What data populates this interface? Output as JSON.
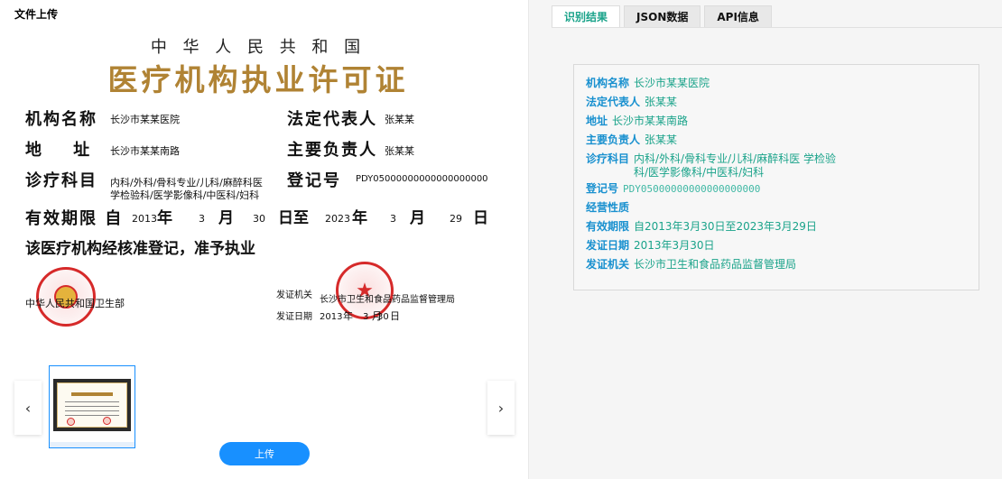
{
  "left": {
    "title": "文件上传",
    "upload_label": "上传",
    "prev_icon": "‹",
    "next_icon": "›"
  },
  "license": {
    "header": "中 华 人 民 共 和 国",
    "title": "医疗机构执业许可证",
    "lbl_name": "机构名称",
    "val_name": "长沙市某某医院",
    "lbl_rep": "法定代表人",
    "val_rep": "张某某",
    "lbl_addr": "地    址",
    "val_addr": "长沙市某某南路",
    "lbl_chief": "主要负责人",
    "val_chief": "张某某",
    "lbl_subj": "诊疗科目",
    "val_subj1": "内科/外科/骨科专业/儿科/麻醉科医",
    "val_subj2": "学检验科/医学影像科/中医科/妇科",
    "lbl_reg": "登记号",
    "val_reg": "PDY05000000000000000000",
    "lbl_valid": "有效期限 自",
    "v_y1": "2013",
    "t_nian1": "年",
    "v_m1": "3",
    "t_yue1": "月",
    "v_d1": "30",
    "t_rizhi": "日至",
    "v_y2": "2023",
    "t_nian2": "年",
    "v_m2": "3",
    "t_yue2": "月",
    "v_d2": "29",
    "t_ri2": "日",
    "approve": "该医疗机构经核准登记，准予执业",
    "ministry": "中华人民共和国卫生部",
    "lbl_issuer": "发证机关",
    "val_issuer": "长沙市卫生和食品药品监督管理局",
    "lbl_issue_date": "发证日期",
    "iss_y": "2013",
    "iss_nian": "年",
    "iss_m": "3",
    "iss_yue": "月",
    "iss_d": "30",
    "iss_ri": "日"
  },
  "right": {
    "tabs": [
      "识别结果",
      "JSON数据",
      "API信息"
    ],
    "fields": [
      {
        "key": "机构名称",
        "value": "长沙市某某医院"
      },
      {
        "key": "法定代表人",
        "value": "张某某"
      },
      {
        "key": "地址",
        "value": "长沙市某某南路"
      },
      {
        "key": "主要负责人",
        "value": "张某某"
      },
      {
        "key": "诊疗科目",
        "value": "内科/外科/骨科专业/儿科/麻醉科医 学检验科/医学影像科/中医科/妇科"
      },
      {
        "key": "登记号",
        "value": "PDY05000000000000000000"
      },
      {
        "key": "经营性质",
        "value": ""
      },
      {
        "key": "有效期限",
        "value": "自2013年3月30日至2023年3月29日"
      },
      {
        "key": "发证日期",
        "value": "2013年3月30日"
      },
      {
        "key": "发证机关",
        "value": "长沙市卫生和食品药品监督管理局"
      }
    ]
  },
  "colors": {
    "accent": "#1890ff",
    "tab_active": "#1aa38a",
    "field_key": "#1890cf",
    "title_gold": "#b08334",
    "seal_red": "#d62a2a"
  }
}
